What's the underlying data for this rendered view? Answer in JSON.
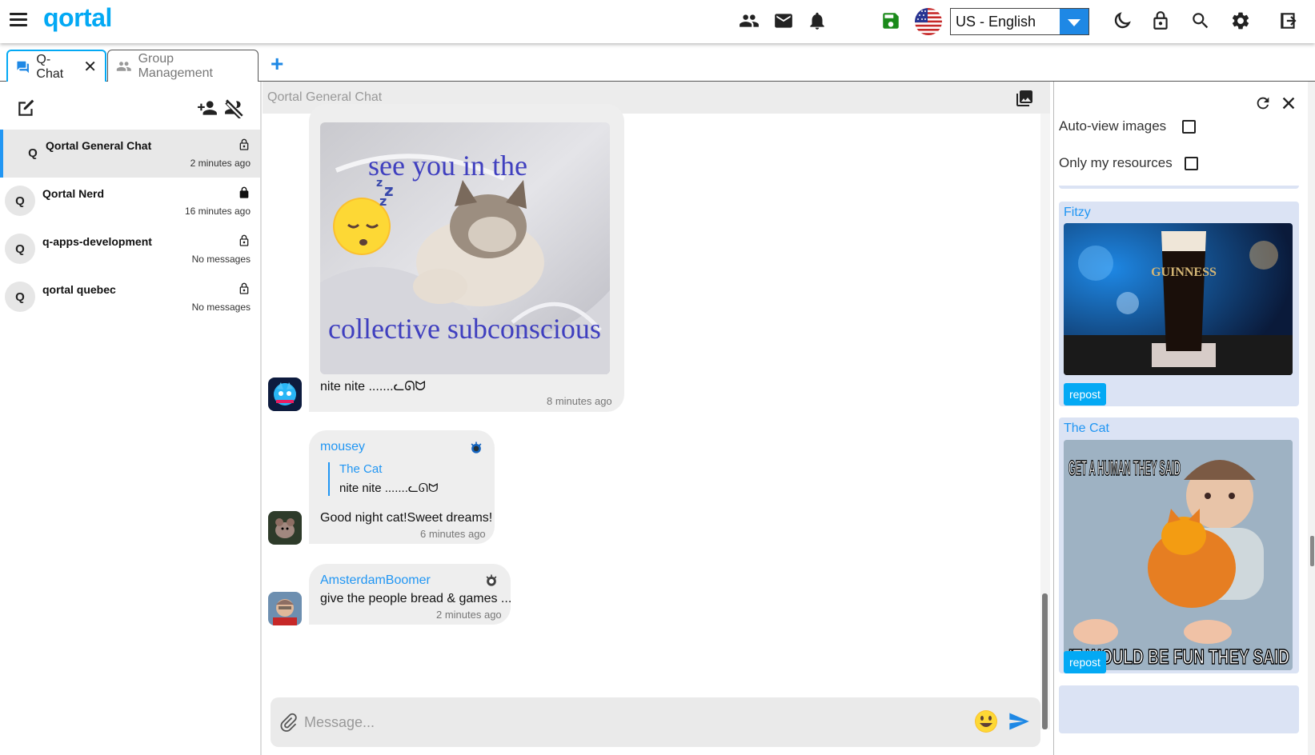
{
  "header": {
    "logo": "qortal",
    "language": "US - English",
    "icons": [
      "users-icon",
      "mail-icon",
      "bell-icon",
      "save-icon",
      "us-flag-icon",
      "moon-icon",
      "lock-icon",
      "search-icon",
      "gear-icon",
      "logout-icon"
    ],
    "accent": "#03a9f4"
  },
  "tabs": [
    {
      "label": "Q-Chat",
      "active": true
    },
    {
      "label": "Group Management",
      "active": false
    }
  ],
  "add_tab": "+",
  "sidebar": {
    "chats": [
      {
        "avatar": "Q",
        "name": "Qortal General Chat",
        "time": "2 minutes ago",
        "locked": false
      },
      {
        "avatar": "Q",
        "name": "Qortal Nerd",
        "time": "16 minutes ago",
        "locked": true
      },
      {
        "avatar": "Q",
        "name": "q-apps-development",
        "time": "No messages",
        "locked": false
      },
      {
        "avatar": "Q",
        "name": "qortal quebec",
        "time": "No messages",
        "locked": false
      }
    ]
  },
  "chat": {
    "title": "Qortal General Chat",
    "image_caption_top": "see you in the",
    "image_caption_bottom": "collective subconscious",
    "messages": [
      {
        "text": "nite nite  .......ᓚᘏᗢ",
        "time": "8 minutes ago"
      },
      {
        "user": "mousey",
        "reply_user": "The Cat",
        "reply_text": "nite nite  .......ᓚᘏᗢ",
        "text": "Good night cat!Sweet dreams!",
        "time": "6 minutes ago"
      },
      {
        "user": "AmsterdamBoomer",
        "text": "give the people bread & games ...",
        "time": "2 minutes ago"
      }
    ],
    "composer_placeholder": "Message..."
  },
  "resources": {
    "auto_view_label": "Auto-view images",
    "only_mine_label": "Only my resources",
    "auto_view_checked": false,
    "only_mine_checked": false,
    "cards": [
      {
        "user": "Fitzy",
        "image_text": "GUINNESS",
        "button": "repost"
      },
      {
        "user": "The Cat",
        "image_text_top": "GET A HUMAN THEY SAID",
        "image_text_bottom": "IT WOULD BE FUN THEY SAID",
        "button": "repost"
      }
    ]
  }
}
